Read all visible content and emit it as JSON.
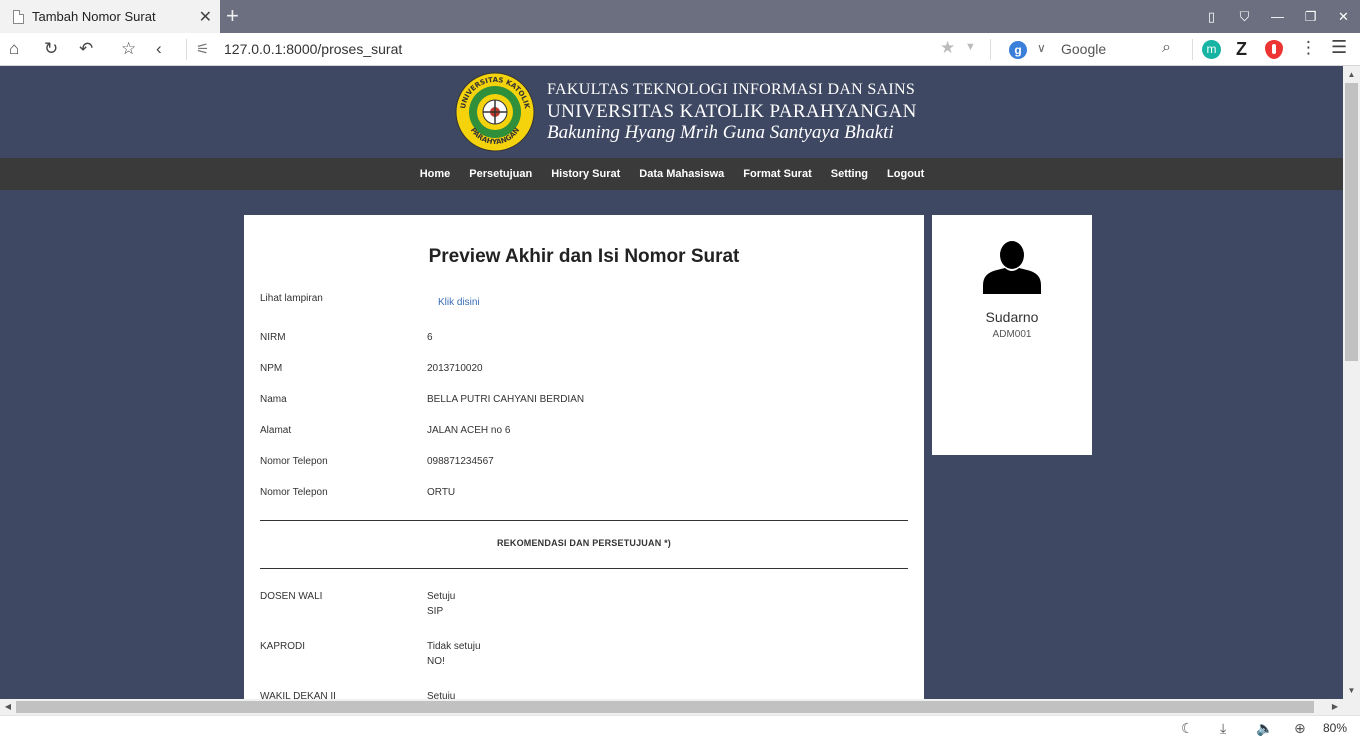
{
  "browser": {
    "tab_title": "Tambah Nomor Surat",
    "tab_close": "✕",
    "new_tab": "+",
    "url": "127.0.0.1:8000/proses_surat",
    "search_engine": "Google",
    "zoom": "80%"
  },
  "header": {
    "line1": "FAKULTAS TEKNOLOGI INFORMASI DAN SAINS",
    "line2": "UNIVERSITAS KATOLIK PARAHYANGAN",
    "line3": "Bakuning Hyang Mrih Guna Santyaya Bhakti",
    "logo_top_text": "UNIVERSITAS KATOLIK",
    "logo_bottom_text": "PARAHYANGAN"
  },
  "menu": {
    "items": [
      "Home",
      "Persetujuan",
      "History Surat",
      "Data Mahasiswa",
      "Format Surat",
      "Setting",
      "Logout"
    ]
  },
  "main": {
    "title": "Preview Akhir dan Isi Nomor Surat",
    "lampiran_label": "Lihat lampiran",
    "lampiran_link": "Klik disini",
    "fields": [
      {
        "label": "NIRM",
        "value": "6"
      },
      {
        "label": "NPM",
        "value": "2013710020"
      },
      {
        "label": "Nama",
        "value": "BELLA PUTRI CAHYANI BERDIAN"
      },
      {
        "label": "Alamat",
        "value": "JALAN ACEH no 6"
      },
      {
        "label": "Nomor Telepon",
        "value": "098871234567"
      },
      {
        "label": "Nomor Telepon",
        "value": "ORTU"
      }
    ],
    "section_title": "REKOMENDASI DAN PERSETUJUAN *)",
    "approvals": [
      {
        "role": "DOSEN WALI",
        "status": "Setuju",
        "note": "SIP"
      },
      {
        "role": "KAPRODI",
        "status": "Tidak setuju",
        "note": "NO!"
      },
      {
        "role": "WAKIL DEKAN II",
        "status": "Setuju",
        "note": ""
      }
    ]
  },
  "profile": {
    "name": "Sudarno",
    "id": "ADM001"
  },
  "colors": {
    "page_bg": "#3e4862",
    "menu_bg": "#3a3a3a",
    "link": "#3a6bb5",
    "logo_yellow": "#f4d20c",
    "logo_green": "#2f8f3a"
  },
  "icons": {
    "home": "⌂",
    "reload": "↻",
    "back_history": "↶",
    "bookmark": "☆",
    "back": "‹",
    "star": "★",
    "dropdown": "▼",
    "search": "⌕",
    "dots": "⋮",
    "hamburger": "☰",
    "moon": "☾",
    "download": "⤓",
    "speaker": "🔈",
    "zoom_in": "⊕",
    "min": "—",
    "restore": "❐",
    "close": "✕",
    "chevron": "∨"
  }
}
